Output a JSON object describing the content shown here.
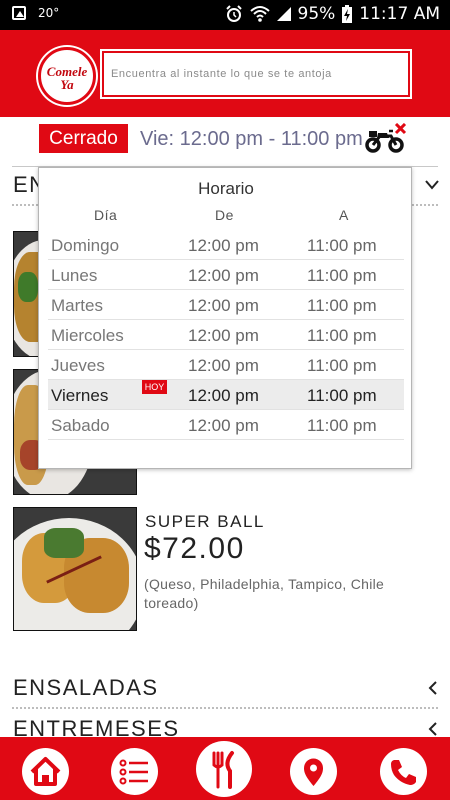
{
  "status_bar": {
    "temperature": "20°",
    "battery": "95%",
    "time": "11:17 AM"
  },
  "header": {
    "logo_line1": "Comele",
    "logo_line2": "Ya",
    "search_placeholder": "Encuentra al instante lo que se te antoja"
  },
  "status": {
    "badge": "Cerrado",
    "hours": "Vie: 12:00 pm - 11:00 pm"
  },
  "categories": {
    "first_partial": "EN",
    "ensaladas": "ENSALADAS",
    "entremeses": "ENTREMESES"
  },
  "product": {
    "name": "SUPER BALL",
    "price": "$72.00",
    "description": "(Queso, Philadelphia, Tampico, Chile toreado)"
  },
  "schedule": {
    "title": "Horario",
    "headers": {
      "day": "Día",
      "from": "De",
      "to": "A"
    },
    "today_badge": "HOY",
    "rows": [
      {
        "day": "Domingo",
        "from": "12:00 pm",
        "to": "11:00 pm"
      },
      {
        "day": "Lunes",
        "from": "12:00 pm",
        "to": "11:00 pm"
      },
      {
        "day": "Martes",
        "from": "12:00 pm",
        "to": "11:00 pm"
      },
      {
        "day": "Miercoles",
        "from": "12:00 pm",
        "to": "11:00 pm"
      },
      {
        "day": "Jueves",
        "from": "12:00 pm",
        "to": "11:00 pm"
      },
      {
        "day": "Viernes",
        "from": "12:00 pm",
        "to": "11:00 pm"
      },
      {
        "day": "Sabado",
        "from": "12:00 pm",
        "to": "11:00 pm"
      }
    ]
  },
  "bottom_nav": {
    "icons": [
      "home-icon",
      "menu-list-icon",
      "fork-knife-icon",
      "location-pin-icon",
      "phone-icon"
    ]
  },
  "colors": {
    "brand_red": "#e00914",
    "hours_text": "#6b6b8e"
  }
}
